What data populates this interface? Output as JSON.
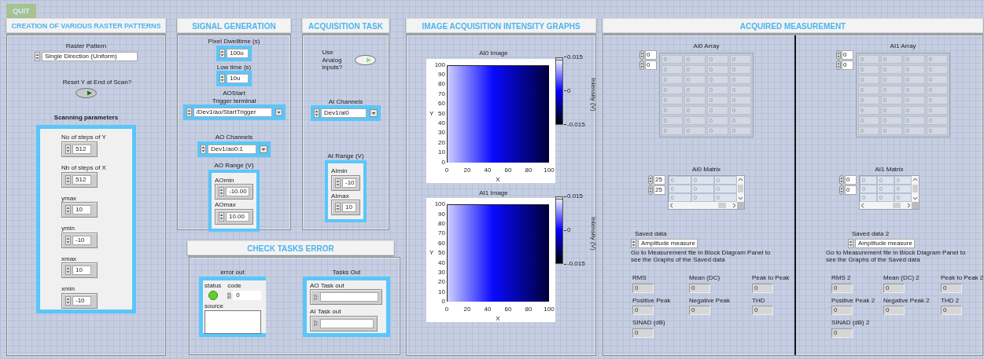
{
  "quit_button": "QUIT",
  "raster_panel": {
    "title": "CREATION OF VARIOUS RASTER PATTERNS",
    "raster_pattern": {
      "label": "Raster Pattern",
      "value": "Single Direction (Uniform)"
    },
    "reset_y": {
      "label": "Reset Y at End of Scan?",
      "on": false
    },
    "scanning_title": "Scanning parameters",
    "params": [
      {
        "label": "No of steps of Y",
        "value": "512"
      },
      {
        "label": "Nb of steps of X",
        "value": "512"
      },
      {
        "label": "ymax",
        "value": "10"
      },
      {
        "label": "ymin",
        "value": "-10"
      },
      {
        "label": "xmax",
        "value": "10"
      },
      {
        "label": "xmin",
        "value": "-10"
      }
    ]
  },
  "signal_panel": {
    "title": "SIGNAL GENERATION",
    "pixel_dwelltime": {
      "label": "Pixel Dwelltime (s)",
      "value": "100u"
    },
    "low_time": {
      "label": "Low time (s)",
      "value": "10u"
    },
    "trigger": {
      "label_lines": [
        "AOStart",
        "Trigger terminal"
      ],
      "value": "/Dev1/ao/StartTrigger"
    },
    "ao_channels": {
      "label": "AO Channels",
      "value": "Dev1/ao0:1"
    },
    "ao_range": {
      "label": "AO Range (V)",
      "fields": [
        {
          "label": "AOmin",
          "value": "-10.00"
        },
        {
          "label": "AOmax",
          "value": "10.00"
        }
      ]
    }
  },
  "acquisition_panel": {
    "title": "ACQUISITION TASK",
    "use_analog": {
      "label": "Use Analog inputs?",
      "on": true
    },
    "ai_channels": {
      "label": "AI Channels",
      "value": "Dev1/ai0"
    },
    "ai_range": {
      "label": "AI Range (V)",
      "fields": [
        {
          "label": "AImin",
          "value": "-10"
        },
        {
          "label": "AImax",
          "value": "10"
        }
      ]
    }
  },
  "error_panel": {
    "title": "CHECK TASKS ERROR",
    "error_out": {
      "label": "error out",
      "status_label": "status",
      "status_ok": true,
      "code_label": "code",
      "code_value": "0",
      "source_label": "source"
    },
    "tasks_out": {
      "label": "Tasks Out",
      "fields": [
        {
          "label": "AO Task out"
        },
        {
          "label": "AI Task out"
        }
      ]
    }
  },
  "graphs_panel": {
    "title": "IMAGE ACQUISITION INTENSITY GRAPHS",
    "graphs": [
      {
        "title": "AI0 Image",
        "x_label": "X",
        "y_label": "Y",
        "x_ticks": [
          "0",
          "20",
          "40",
          "60",
          "80",
          "100"
        ],
        "y_ticks": [
          "100",
          "90",
          "80",
          "70",
          "60",
          "50",
          "40",
          "30",
          "20",
          "10",
          "0"
        ],
        "scale_ticks": [
          "0.015",
          "0",
          "-0.015"
        ],
        "scale_label": "Intensity (V)"
      },
      {
        "title": "AI1 Image",
        "x_label": "X",
        "y_label": "Y",
        "x_ticks": [
          "0",
          "20",
          "40",
          "60",
          "80",
          "100"
        ],
        "y_ticks": [
          "100",
          "90",
          "80",
          "70",
          "60",
          "50",
          "40",
          "30",
          "20",
          "10",
          "0"
        ],
        "scale_ticks": [
          "0.015",
          "0",
          "-0.015"
        ],
        "scale_label": "Intensity (V)"
      }
    ]
  },
  "measurement_panel": {
    "title": "ACQUIRED MEASUREMENT",
    "channels": [
      {
        "array": {
          "label": "AI0 Array",
          "indices": [
            "0",
            "0"
          ],
          "rows": [
            [
              "0",
              "0",
              "0",
              "0"
            ],
            [
              "0",
              "0",
              "0",
              "0"
            ],
            [
              "0",
              "0",
              "0",
              "0"
            ],
            [
              "0",
              "0",
              "0",
              "0"
            ],
            [
              "0",
              "0",
              "0",
              "0"
            ],
            [
              "0",
              "0",
              "0",
              "0"
            ],
            [
              "0",
              "0",
              "0",
              "0"
            ],
            [
              "0",
              "0",
              "0",
              "0"
            ]
          ]
        },
        "matrix": {
          "label": "AI0 Matrix",
          "indices": [
            "25",
            "25"
          ],
          "rows": [
            [
              "0",
              "0",
              "0"
            ],
            [
              "0",
              "0",
              "0"
            ],
            [
              "0",
              "0",
              "0"
            ]
          ]
        },
        "saved": {
          "label": "Saved data",
          "value": "Amplitude measure"
        },
        "note": "Go to Measurement file in Block Diagram Panel to see the Graphs of the Saved data",
        "measures": [
          {
            "label": "RMS",
            "value": "0"
          },
          {
            "label": "Mean (DC)",
            "value": "0"
          },
          {
            "label": "Peak to Peak",
            "value": "0"
          },
          {
            "label": "Positive Peak",
            "value": "0"
          },
          {
            "label": "Negative Peak",
            "value": "0"
          },
          {
            "label": "THD",
            "value": "0"
          },
          {
            "label": "SINAD (dB)",
            "value": "0"
          }
        ]
      },
      {
        "array": {
          "label": "AI1 Array",
          "indices": [
            "0",
            "0"
          ],
          "rows": [
            [
              "0",
              "0",
              "0",
              "0"
            ],
            [
              "0",
              "0",
              "0",
              "0"
            ],
            [
              "0",
              "0",
              "0",
              "0"
            ],
            [
              "0",
              "0",
              "0",
              "0"
            ],
            [
              "0",
              "0",
              "0",
              "0"
            ],
            [
              "0",
              "0",
              "0",
              "0"
            ],
            [
              "0",
              "0",
              "0",
              "0"
            ],
            [
              "0",
              "0",
              "0",
              "0"
            ]
          ]
        },
        "matrix": {
          "label": "AI1 Matrix",
          "indices": [
            "0",
            "0"
          ],
          "rows": [
            [
              "0",
              "0",
              "0"
            ],
            [
              "0",
              "0",
              "0"
            ],
            [
              "0",
              "0",
              "0"
            ]
          ]
        },
        "saved": {
          "label": "Saved data 2",
          "value": "Amplitude measure"
        },
        "note": "Go to Measurement file in Block Diagram Panel to see the Graphs of the Saved data",
        "measures": [
          {
            "label": "RMS 2",
            "value": "0"
          },
          {
            "label": "Mean (DC) 2",
            "value": "0"
          },
          {
            "label": "Peak to Peak 2",
            "value": "0"
          },
          {
            "label": "Positive Peak 2",
            "value": "0"
          },
          {
            "label": "Negative Peak 2",
            "value": "0"
          },
          {
            "label": "THD 2",
            "value": "0"
          },
          {
            "label": "SINAD (dB) 2",
            "value": "0"
          }
        ]
      }
    ]
  }
}
